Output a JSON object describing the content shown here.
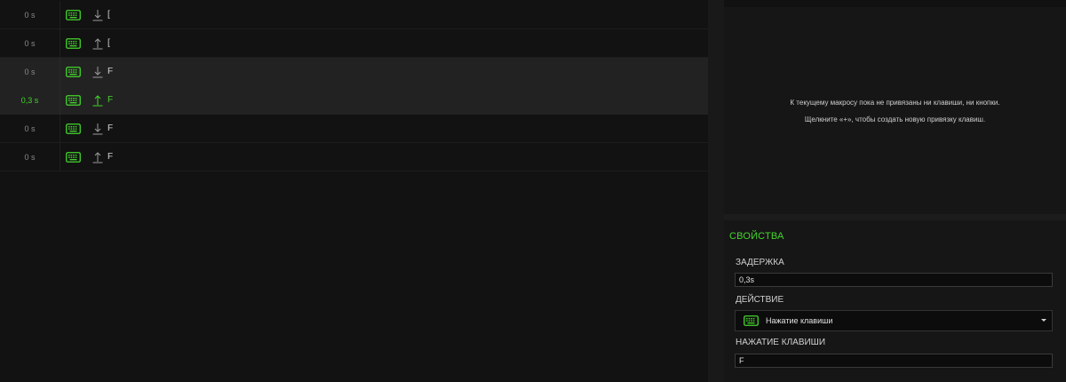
{
  "colors": {
    "accent": "#44d62c",
    "background": "#111111",
    "panel": "#161616",
    "highlight_row": "#222222"
  },
  "events": [
    {
      "time": "0 s",
      "device_icon": "keyboard-icon",
      "direction": "down",
      "direction_icon": "arrow-down-icon",
      "key": "[",
      "highlighted": false,
      "active": false
    },
    {
      "time": "0 s",
      "device_icon": "keyboard-icon",
      "direction": "up",
      "direction_icon": "arrow-up-icon",
      "key": "[",
      "highlighted": false,
      "active": false
    },
    {
      "time": "0 s",
      "device_icon": "keyboard-icon",
      "direction": "down",
      "direction_icon": "arrow-down-icon",
      "key": "F",
      "highlighted": true,
      "active": false
    },
    {
      "time": "0,3 s",
      "device_icon": "keyboard-icon",
      "direction": "up",
      "direction_icon": "arrow-up-icon",
      "key": "F",
      "highlighted": true,
      "active": true
    },
    {
      "time": "0 s",
      "device_icon": "keyboard-icon",
      "direction": "down",
      "direction_icon": "arrow-down-icon",
      "key": "F",
      "highlighted": false,
      "active": false
    },
    {
      "time": "0 s",
      "device_icon": "keyboard-icon",
      "direction": "up",
      "direction_icon": "arrow-up-icon",
      "key": "F",
      "highlighted": false,
      "active": false
    }
  ],
  "bindings": {
    "empty_message": "К текущему макросу пока не привязаны ни клавиши, ни кнопки.",
    "hint": "Щелкните «+», чтобы создать новую привязку клавиш."
  },
  "properties": {
    "title": "СВОЙСТВА",
    "delay_label": "ЗАДЕРЖКА",
    "delay_value": "0,3s",
    "action_label": "ДЕЙСТВИЕ",
    "action_icon": "keyboard-icon",
    "action_value": "Нажатие клавиши",
    "key_label": "НАЖАТИЕ КЛАВИШИ",
    "key_value": "F"
  }
}
